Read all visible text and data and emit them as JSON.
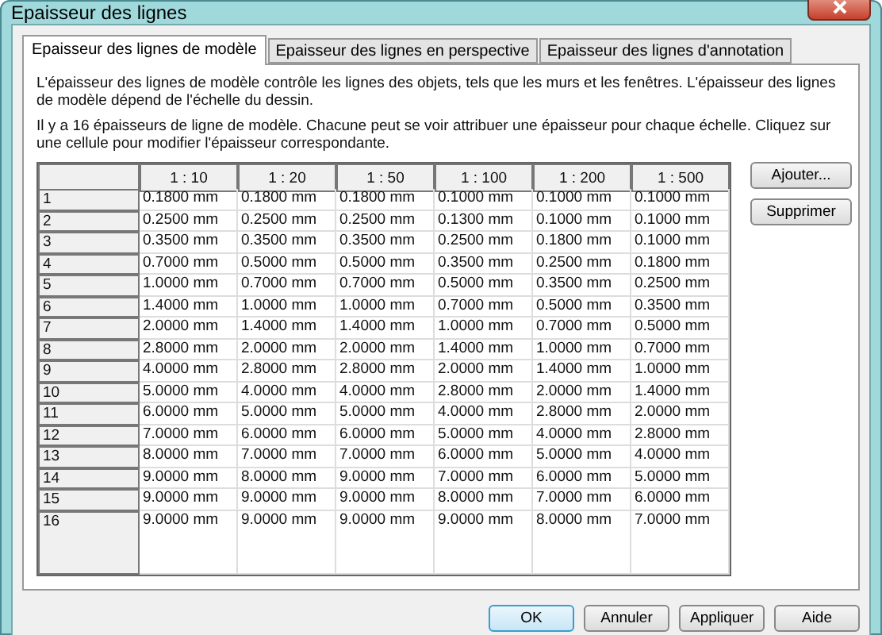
{
  "window": {
    "title": "Epaisseur des lignes"
  },
  "tabs": [
    {
      "label": "Epaisseur des lignes de modèle",
      "selected": true
    },
    {
      "label": "Epaisseur des lignes en perspective",
      "selected": false
    },
    {
      "label": "Epaisseur des lignes d'annotation",
      "selected": false
    }
  ],
  "description": [
    "L'épaisseur des lignes de modèle contrôle les lignes des objets, tels que les murs et les fenêtres. L'épaisseur des lignes de modèle dépend de l'échelle du dessin.",
    "Il y a 16 épaisseurs de ligne de modèle. Chacune peut se voir attribuer une épaisseur pour chaque échelle. Cliquez sur une cellule pour modifier l'épaisseur correspondante."
  ],
  "table": {
    "columns": [
      "1 : 10",
      "1 : 20",
      "1 : 50",
      "1 : 100",
      "1 : 200",
      "1 : 500"
    ],
    "rows": [
      {
        "label": "1",
        "cells": [
          "0.1800 mm",
          "0.1800 mm",
          "0.1800 mm",
          "0.1000 mm",
          "0.1000 mm",
          "0.1000 mm"
        ]
      },
      {
        "label": "2",
        "cells": [
          "0.2500 mm",
          "0.2500 mm",
          "0.2500 mm",
          "0.1300 mm",
          "0.1000 mm",
          "0.1000 mm"
        ]
      },
      {
        "label": "3",
        "cells": [
          "0.3500 mm",
          "0.3500 mm",
          "0.3500 mm",
          "0.2500 mm",
          "0.1800 mm",
          "0.1000 mm"
        ]
      },
      {
        "label": "4",
        "cells": [
          "0.7000 mm",
          "0.5000 mm",
          "0.5000 mm",
          "0.3500 mm",
          "0.2500 mm",
          "0.1800 mm"
        ]
      },
      {
        "label": "5",
        "cells": [
          "1.0000 mm",
          "0.7000 mm",
          "0.7000 mm",
          "0.5000 mm",
          "0.3500 mm",
          "0.2500 mm"
        ]
      },
      {
        "label": "6",
        "cells": [
          "1.4000 mm",
          "1.0000 mm",
          "1.0000 mm",
          "0.7000 mm",
          "0.5000 mm",
          "0.3500 mm"
        ]
      },
      {
        "label": "7",
        "cells": [
          "2.0000 mm",
          "1.4000 mm",
          "1.4000 mm",
          "1.0000 mm",
          "0.7000 mm",
          "0.5000 mm"
        ]
      },
      {
        "label": "8",
        "cells": [
          "2.8000 mm",
          "2.0000 mm",
          "2.0000 mm",
          "1.4000 mm",
          "1.0000 mm",
          "0.7000 mm"
        ]
      },
      {
        "label": "9",
        "cells": [
          "4.0000 mm",
          "2.8000 mm",
          "2.8000 mm",
          "2.0000 mm",
          "1.4000 mm",
          "1.0000 mm"
        ]
      },
      {
        "label": "10",
        "cells": [
          "5.0000 mm",
          "4.0000 mm",
          "4.0000 mm",
          "2.8000 mm",
          "2.0000 mm",
          "1.4000 mm"
        ]
      },
      {
        "label": "11",
        "cells": [
          "6.0000 mm",
          "5.0000 mm",
          "5.0000 mm",
          "4.0000 mm",
          "2.8000 mm",
          "2.0000 mm"
        ]
      },
      {
        "label": "12",
        "cells": [
          "7.0000 mm",
          "6.0000 mm",
          "6.0000 mm",
          "5.0000 mm",
          "4.0000 mm",
          "2.8000 mm"
        ]
      },
      {
        "label": "13",
        "cells": [
          "8.0000 mm",
          "7.0000 mm",
          "7.0000 mm",
          "6.0000 mm",
          "5.0000 mm",
          "4.0000 mm"
        ]
      },
      {
        "label": "14",
        "cells": [
          "9.0000 mm",
          "8.0000 mm",
          "9.0000 mm",
          "7.0000 mm",
          "6.0000 mm",
          "5.0000 mm"
        ]
      },
      {
        "label": "15",
        "cells": [
          "9.0000 mm",
          "9.0000 mm",
          "9.0000 mm",
          "8.0000 mm",
          "7.0000 mm",
          "6.0000 mm"
        ]
      },
      {
        "label": "16",
        "cells": [
          "9.0000 mm",
          "9.0000 mm",
          "9.0000 mm",
          "9.0000 mm",
          "8.0000 mm",
          "7.0000 mm"
        ]
      }
    ]
  },
  "side_buttons": [
    "Ajouter...",
    "Supprimer"
  ],
  "buttons": [
    {
      "label": "OK",
      "default": true
    },
    {
      "label": "Annuler",
      "default": false
    },
    {
      "label": "Appliquer",
      "default": false
    },
    {
      "label": "Aide",
      "default": false
    }
  ]
}
